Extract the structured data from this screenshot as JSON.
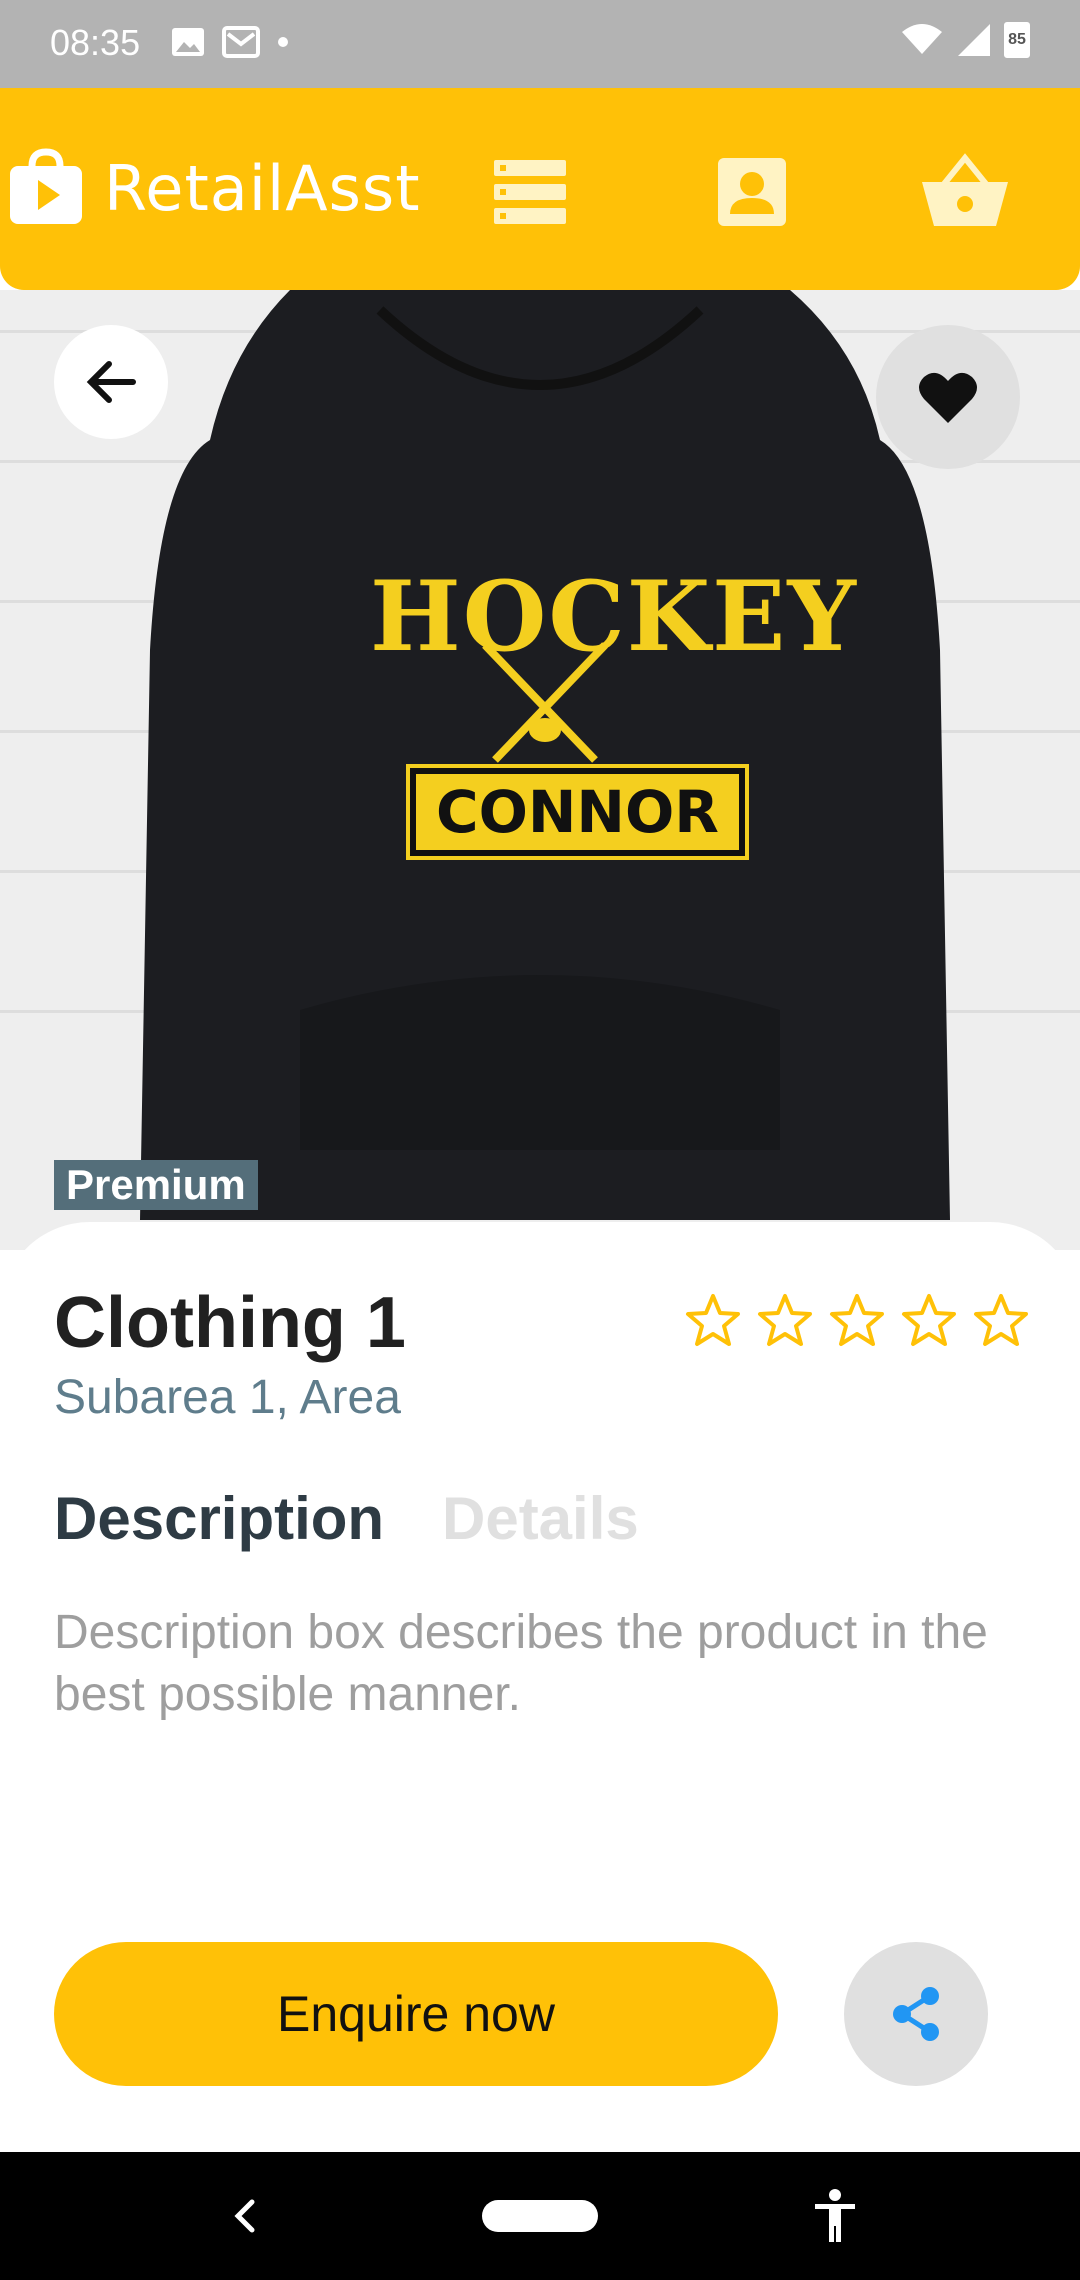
{
  "status_bar": {
    "time": "08:35",
    "battery": "85"
  },
  "app_bar": {
    "title": "RetailAsst"
  },
  "product": {
    "badge": "Premium",
    "name": "Clothing 1",
    "location": "Subarea 1, Area",
    "rating": 0,
    "rating_max": 5,
    "image_text": {
      "top": "HOCKEY",
      "name": "CONNOR"
    }
  },
  "tabs": [
    {
      "label": "Description",
      "active": true
    },
    {
      "label": "Details",
      "active": false
    }
  ],
  "description": "Description box describes the product in the best possible manner.",
  "actions": {
    "enquire_label": "Enquire now"
  },
  "colors": {
    "accent": "#ffc107",
    "share": "#2196f3"
  }
}
